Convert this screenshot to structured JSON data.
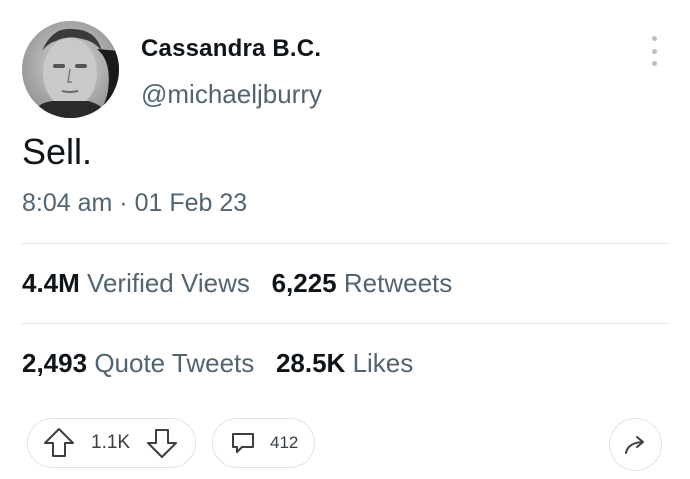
{
  "author": {
    "display_name": "Cassandra B.C.",
    "handle": "@michaeljburry",
    "avatar_icon": "profile-photo"
  },
  "tweet": {
    "text": "Sell.",
    "time": "8:04 am",
    "separator": "·",
    "date": "01 Feb 23"
  },
  "stats": {
    "views": {
      "value": "4.4M",
      "label": "Verified Views"
    },
    "retweets": {
      "value": "6,225",
      "label": "Retweets"
    },
    "quote_tweets": {
      "value": "2,493",
      "label": "Quote Tweets"
    },
    "likes": {
      "value": "28.5K",
      "label": "Likes"
    }
  },
  "actions": {
    "vote_count": "1.1K",
    "reply_count": "412",
    "icons": {
      "upvote": "arrow-up-icon",
      "downvote": "arrow-down-icon",
      "reply": "comment-icon",
      "share": "share-icon",
      "more": "more-vertical-icon"
    }
  },
  "colors": {
    "text_primary": "#0f1419",
    "text_secondary": "#536471",
    "divider": "#e3e6e8",
    "background": "#ffffff"
  }
}
